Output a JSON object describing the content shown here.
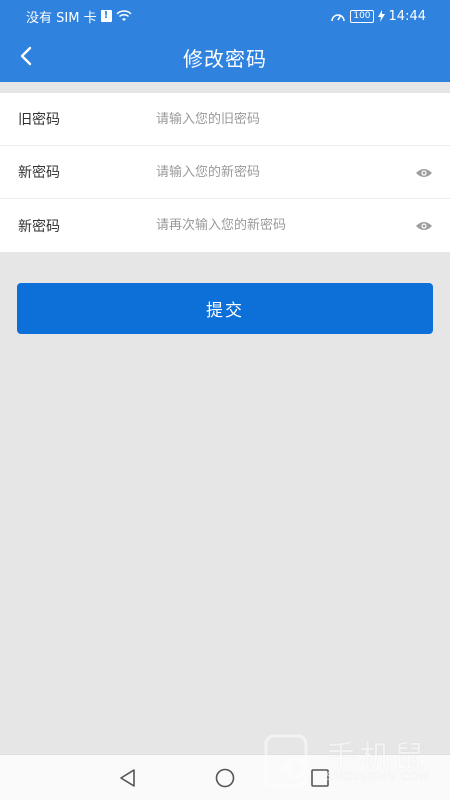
{
  "status_bar": {
    "carrier": "没有 SIM 卡",
    "sim_alert": "!",
    "battery": "100",
    "time": "14:44"
  },
  "header": {
    "title": "修改密码",
    "back_icon": "chevron-left-icon"
  },
  "form": {
    "rows": [
      {
        "label": "旧密码",
        "placeholder": "请输入您的旧密码",
        "value": ""
      },
      {
        "label": "新密码",
        "placeholder": "请输入您的新密码",
        "value": "",
        "toggle_icon": "eye-icon"
      },
      {
        "label": "新密码",
        "placeholder": "请再次输入您的新密码",
        "value": "",
        "toggle_icon": "eye-icon"
      }
    ]
  },
  "submit": {
    "label": "提交"
  },
  "watermark": {
    "title": "手机鼠",
    "subtitle": "SHOUJISHU.COM"
  },
  "colors": {
    "primary": "#2f82de",
    "button": "#0d6fd8",
    "background": "#e6e6e6"
  }
}
